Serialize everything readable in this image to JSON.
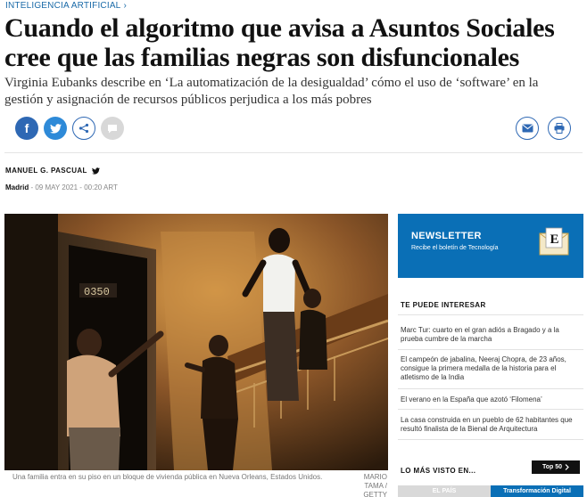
{
  "section": {
    "label": "INTELIGENCIA ARTIFICIAL",
    "chevron": "›"
  },
  "article": {
    "headline": "Cuando el algoritmo que avisa a Asuntos Sociales cree que las familias negras son disfuncionales",
    "subhead": "Virginia Eubanks describe en ‘La automatización de la desigualdad’ cómo el uso de ‘software’ en la gestión y asignación de recursos públicos perjudica a los más pobres",
    "author": "MANUEL G. PASCUAL",
    "city": "Madrid",
    "date": " - 09 MAY 2021 - 00:20 ART",
    "caption": "Una familia entra en su piso en un bloque de vivienda pública en Nueva Orleans, Estados Unidos.",
    "credit": "MARIO TAMA / GETTY",
    "door_number": "0350"
  },
  "share": {
    "facebook": "f",
    "twitter": "twitter-icon",
    "share": "share-icon",
    "comments": "comment-icon",
    "email": "email-icon",
    "print": "print-icon"
  },
  "newsletter": {
    "title": "NEWSLETTER",
    "subtitle": "Recibe el boletín de Tecnología",
    "envelope_letter": "E"
  },
  "interest": {
    "title": "TE PUEDE INTERESAR",
    "items": [
      "Marc Tur: cuarto en el gran adiós a Bragado y a la prueba cumbre de la marcha",
      "El campeón de jabalina, Neeraj Chopra, de 23 años, consigue la primera medalla de la historia para el atletismo de la India",
      "El verano en la España que azotó ‘Filomena’",
      "La casa construida en un pueblo de 62 habitantes que resultó finalista de la Bienal de Arquitectura"
    ]
  },
  "most_viewed": {
    "title": "LO MÁS VISTO EN...",
    "top50": "Top 50",
    "tabs": [
      "EL PAÍS",
      "Transformación Digital"
    ]
  },
  "colors": {
    "accent": "#0a6fb6",
    "link": "#1a6aa8"
  }
}
